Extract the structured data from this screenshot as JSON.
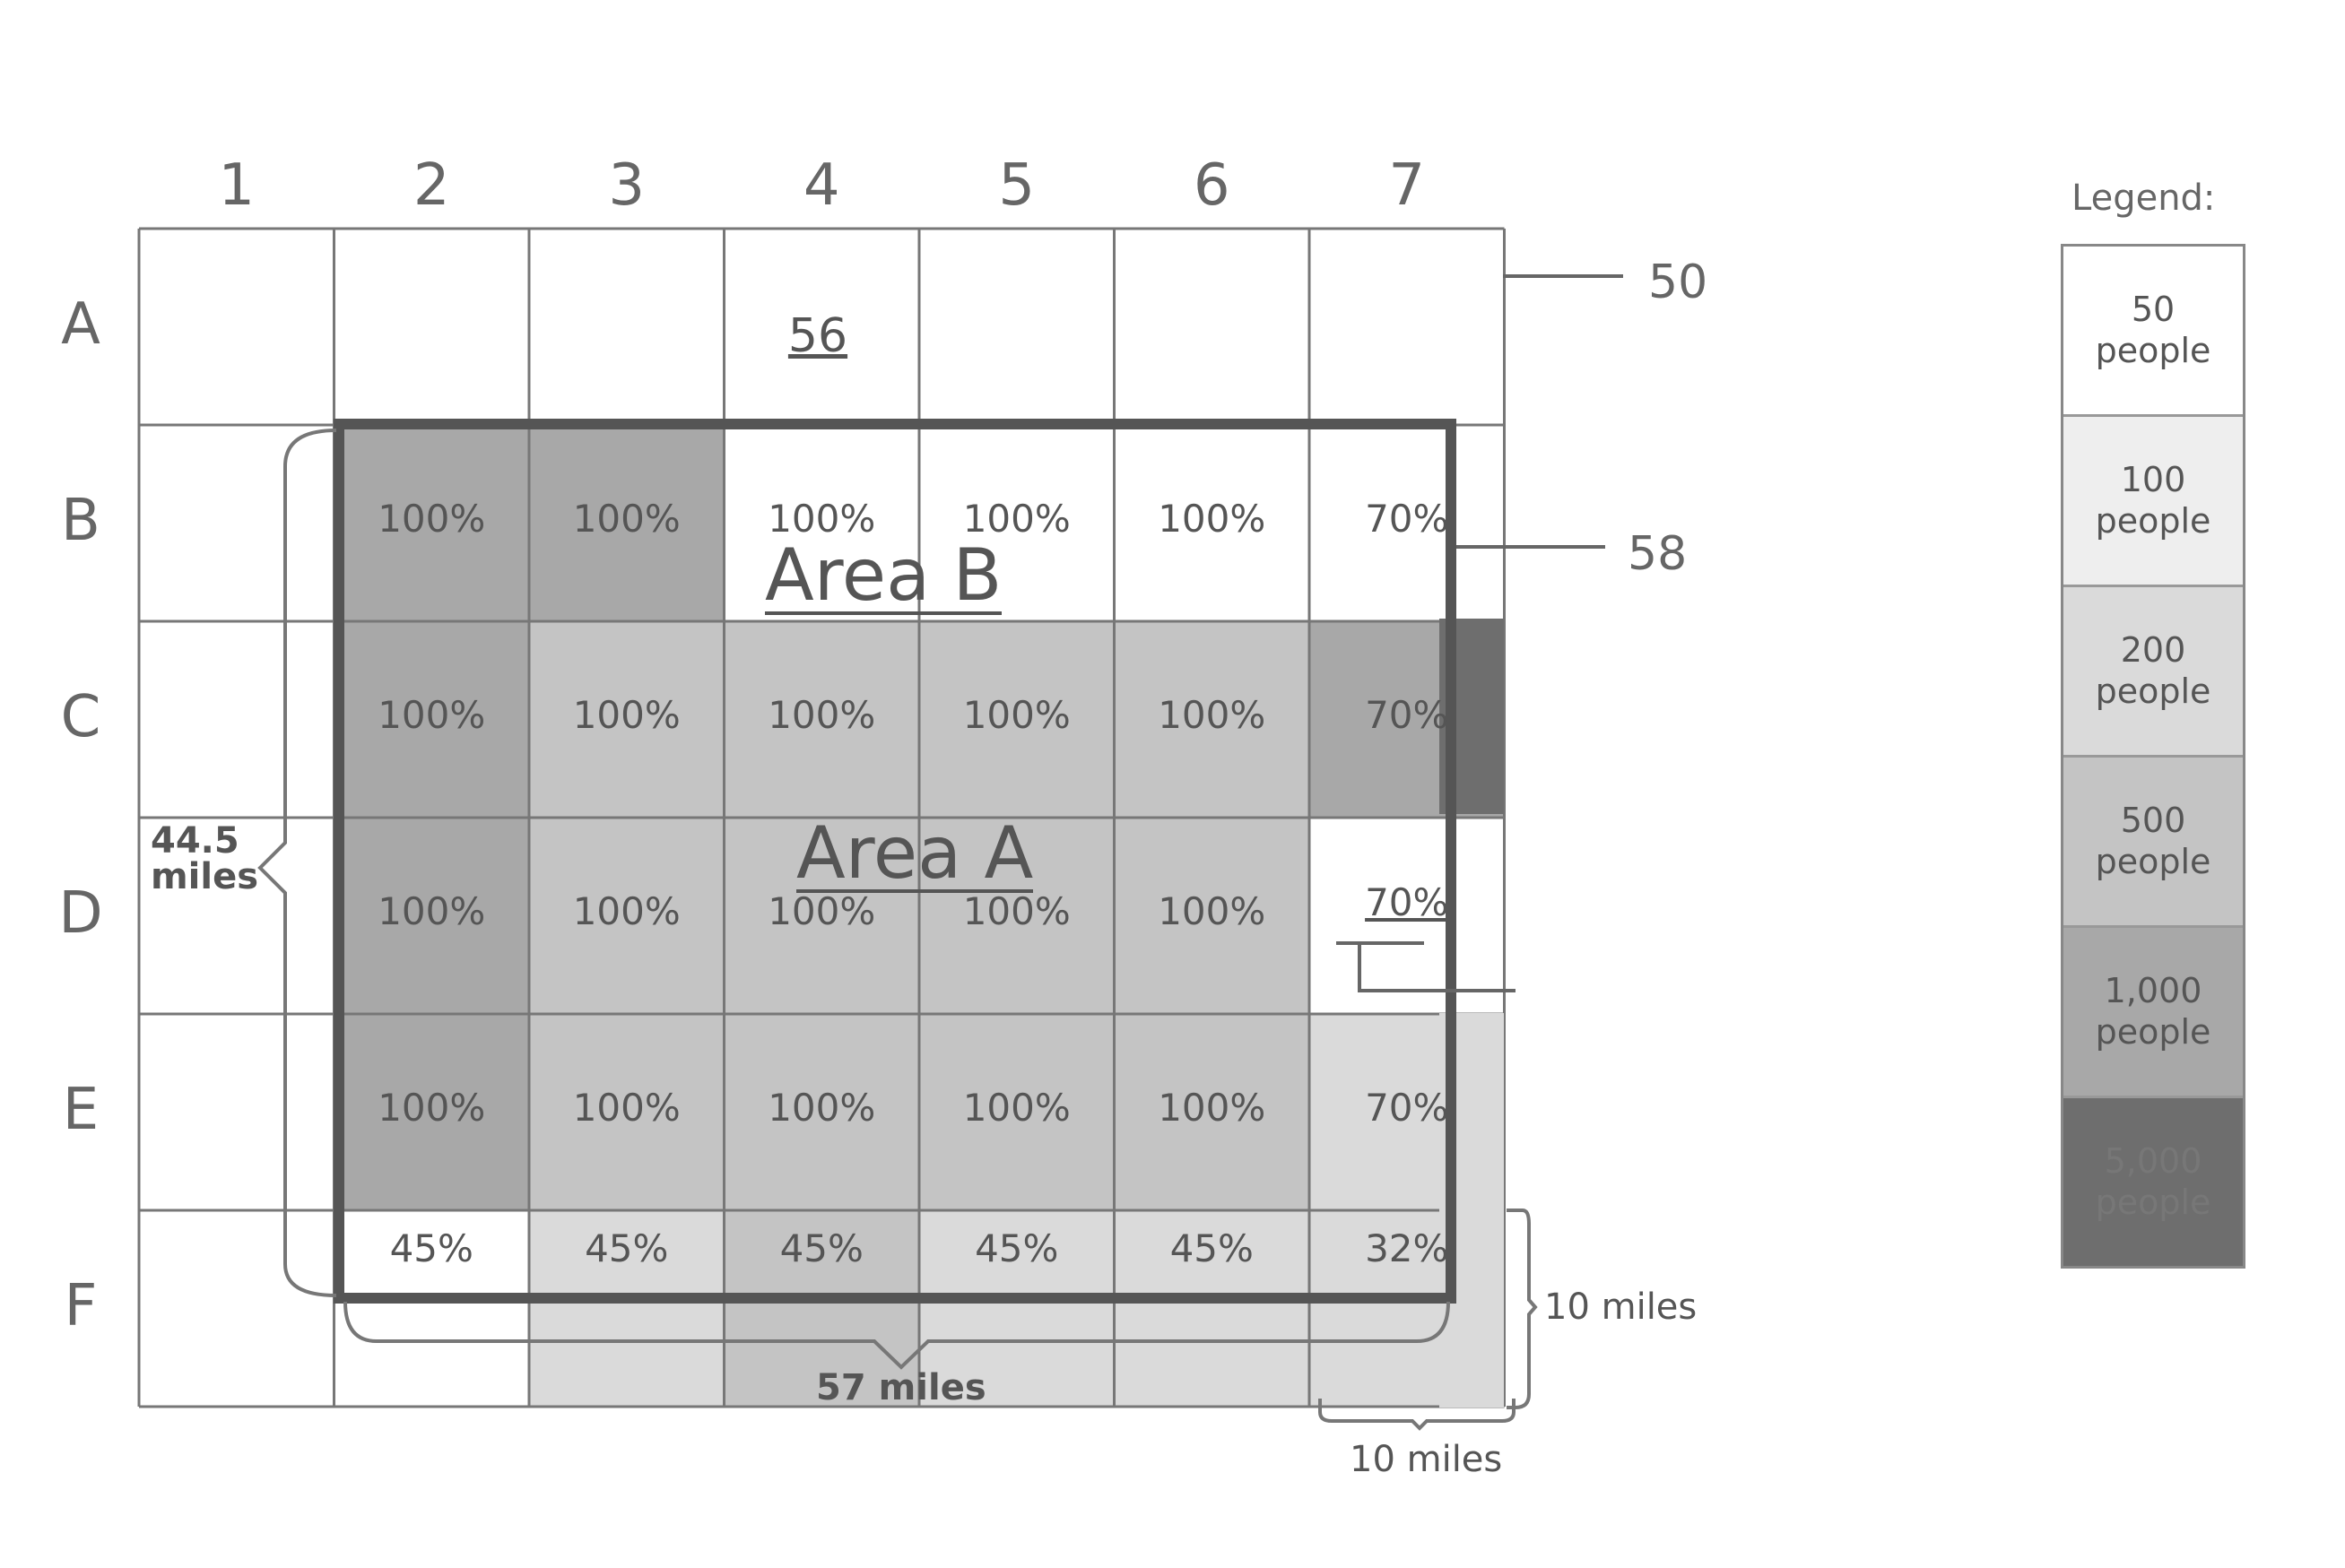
{
  "grid": {
    "columns": [
      "1",
      "2",
      "3",
      "4",
      "5",
      "6",
      "7"
    ],
    "rows": [
      "A",
      "B",
      "C",
      "D",
      "E",
      "F"
    ],
    "cells": [
      {
        "row": "B",
        "col": 2,
        "text": "100%",
        "density": "1,000 people"
      },
      {
        "row": "B",
        "col": 3,
        "text": "100%",
        "density": "1,000 people"
      },
      {
        "row": "B",
        "col": 4,
        "text": "100%",
        "density": "50 people"
      },
      {
        "row": "B",
        "col": 5,
        "text": "100%",
        "density": "50 people"
      },
      {
        "row": "B",
        "col": 6,
        "text": "100%",
        "density": "50 people"
      },
      {
        "row": "B",
        "col": 7,
        "text": "70%",
        "density": "50 people"
      },
      {
        "row": "C",
        "col": 2,
        "text": "100%",
        "density": "1,000 people"
      },
      {
        "row": "C",
        "col": 3,
        "text": "100%",
        "density": "500 people"
      },
      {
        "row": "C",
        "col": 4,
        "text": "100%",
        "density": "500 people"
      },
      {
        "row": "C",
        "col": 5,
        "text": "100%",
        "density": "500 people"
      },
      {
        "row": "C",
        "col": 6,
        "text": "100%",
        "density": "500 people"
      },
      {
        "row": "C",
        "col": 7,
        "text": "70%",
        "density": "1,000 people"
      },
      {
        "row": "D",
        "col": 2,
        "text": "100%",
        "density": "1,000 people"
      },
      {
        "row": "D",
        "col": 3,
        "text": "100%",
        "density": "500 people"
      },
      {
        "row": "D",
        "col": 4,
        "text": "100%",
        "density": "500 people"
      },
      {
        "row": "D",
        "col": 5,
        "text": "100%",
        "density": "500 people"
      },
      {
        "row": "D",
        "col": 6,
        "text": "100%",
        "density": "500 people"
      },
      {
        "row": "D",
        "col": 7,
        "text": "70%",
        "density": "50 people"
      },
      {
        "row": "E",
        "col": 2,
        "text": "100%",
        "density": "1,000 people"
      },
      {
        "row": "E",
        "col": 3,
        "text": "100%",
        "density": "500 people"
      },
      {
        "row": "E",
        "col": 4,
        "text": "100%",
        "density": "500 people"
      },
      {
        "row": "E",
        "col": 5,
        "text": "100%",
        "density": "500 people"
      },
      {
        "row": "E",
        "col": 6,
        "text": "100%",
        "density": "500 people"
      },
      {
        "row": "E",
        "col": 7,
        "text": "70%",
        "density": "200 people"
      },
      {
        "row": "F",
        "col": 2,
        "text": "45%",
        "density": "50 people"
      },
      {
        "row": "F",
        "col": 3,
        "text": "45%",
        "density": "200 people"
      },
      {
        "row": "F",
        "col": 4,
        "text": "45%",
        "density": "500 people"
      },
      {
        "row": "F",
        "col": 5,
        "text": "45%",
        "density": "200 people"
      },
      {
        "row": "F",
        "col": 6,
        "text": "45%",
        "density": "200 people"
      },
      {
        "row": "F",
        "col": 7,
        "text": "32%",
        "density": "200 people"
      }
    ],
    "cell_56_label": "56"
  },
  "annotations": {
    "ref_50": "50",
    "ref_58": "58",
    "area_a": "Area A",
    "area_b": "Area B",
    "dim_vertical": [
      "44.5",
      "miles"
    ],
    "dim_horizontal": "57 miles",
    "dim_cell_height": "10 miles",
    "dim_cell_width": "10 miles"
  },
  "legend": {
    "title": "Legend:",
    "items": [
      {
        "value": "50",
        "unit": "people",
        "color": "#ffffff"
      },
      {
        "value": "100",
        "unit": "people",
        "color": "#eeeeee"
      },
      {
        "value": "200",
        "unit": "people",
        "color": "#dadada"
      },
      {
        "value": "500",
        "unit": "people",
        "color": "#c4c4c4"
      },
      {
        "value": "1,000",
        "unit": "people",
        "color": "#a8a8a8"
      },
      {
        "value": "5,000",
        "unit": "people",
        "color": "#6e6e6e"
      }
    ]
  }
}
